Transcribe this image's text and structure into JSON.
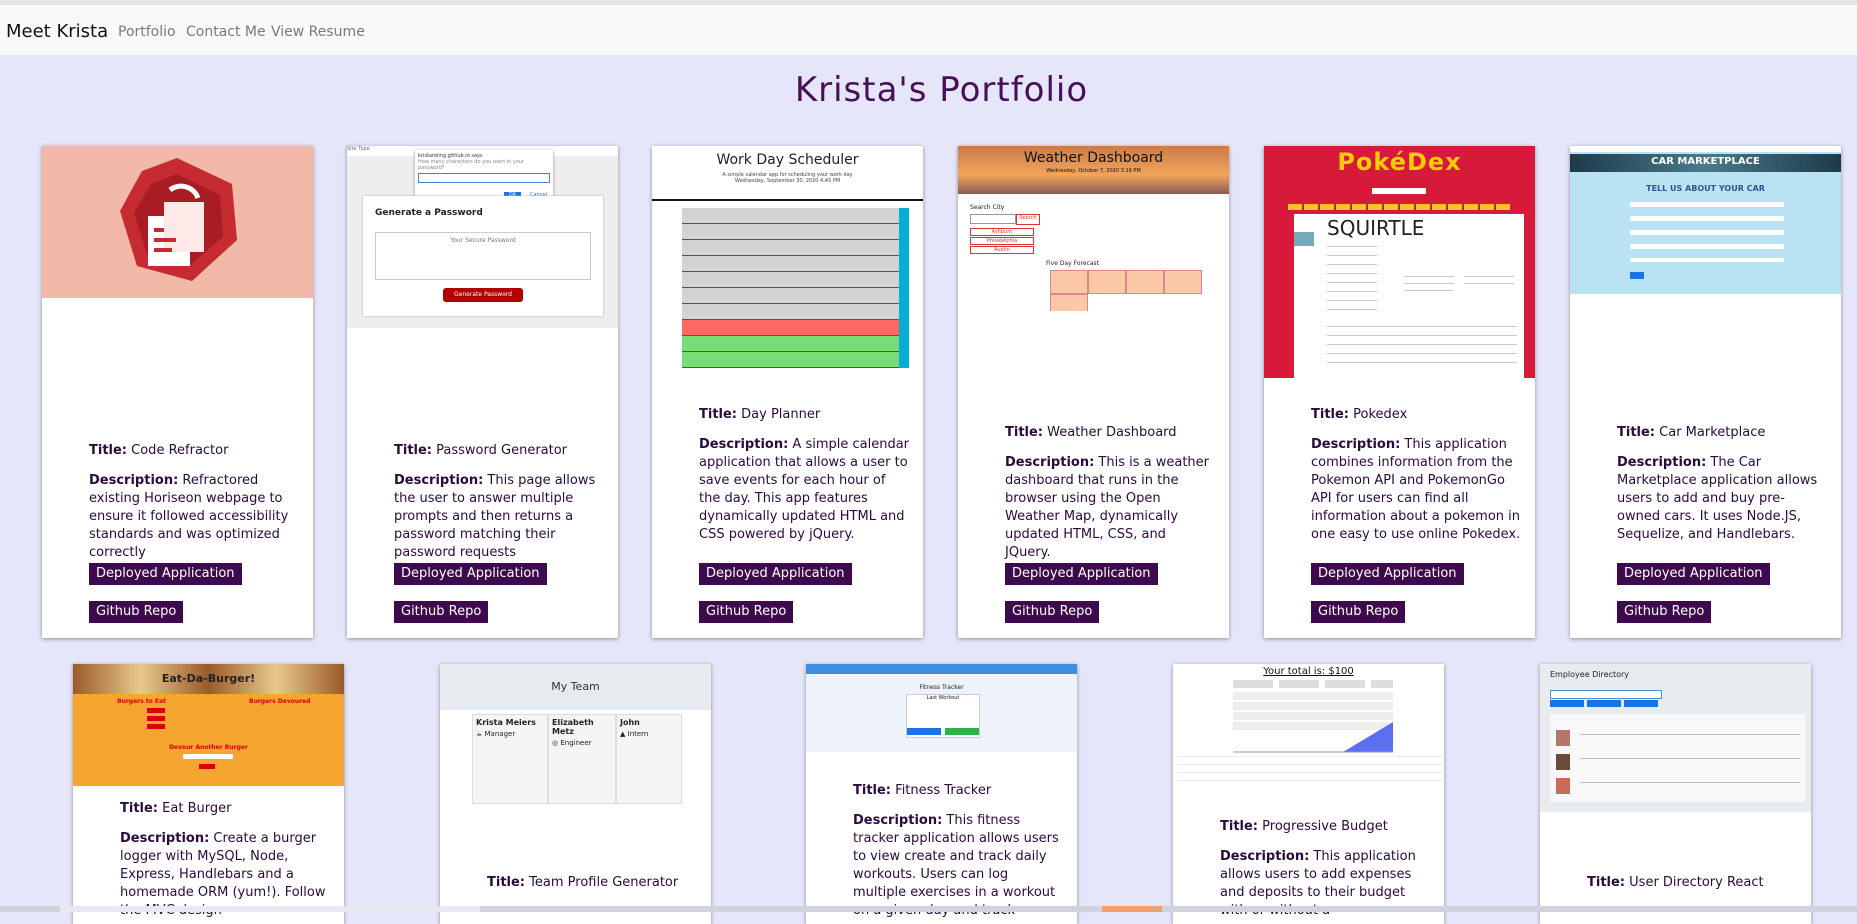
{
  "nav": {
    "brand": "Meet Krista",
    "links": [
      "Portfolio",
      "Contact Me",
      "View Resume"
    ]
  },
  "page_title": "Krista's Portfolio",
  "labels": {
    "title": "Title:",
    "description": "Description:",
    "deployed": "Deployed Application",
    "github": "Github Repo"
  },
  "projects": [
    {
      "title": "Code Refractor",
      "description": "Refractored existing Horiseon webpage to ensure it followed accessibility standards and was optimized correctly"
    },
    {
      "title": "Password Generator",
      "description": "This page allows the user to answer multiple prompts and then returns a password matching their password requests"
    },
    {
      "title": "Day Planner",
      "description": "A simple calendar application that allows a user to save events for each hour of the day. This app features dynamically updated HTML and CSS powered by jQuery."
    },
    {
      "title": "Weather Dashboard",
      "description": "This is a weather dashboard that runs in the browser using the Open Weather Map, dynamically updated HTML, CSS, and JQuery."
    },
    {
      "title": "Pokedex",
      "description": "This application combines information from the Pokemon API and PokemonGo API for users can find all information about a pokemon in one easy to use online Pokedex."
    },
    {
      "title": "Car Marketplace",
      "description": "The Car Marketplace application allows users to add and buy pre-owned cars. It uses Node.JS, Sequelize, and Handlebars."
    },
    {
      "title": "Eat Burger",
      "description": "Create a burger logger with MySQL, Node, Express, Handlebars and a homemade ORM (yum!). Follow the MVC design"
    },
    {
      "title": "Team Profile Generator",
      "description": ""
    },
    {
      "title": "Fitness Tracker",
      "description": "This fitness tracker application allows users to view create and track daily workouts. Users can log multiple exercises in a workout on a given day and track"
    },
    {
      "title": "Progressive Budget",
      "description": "This application allows users to add expenses and deposits to their budget with or without a"
    },
    {
      "title": "User Directory React",
      "description": ""
    }
  ],
  "thumbs": {
    "password": {
      "site_text": "Site Type",
      "dialog_title": "kristaroling.github.io says",
      "dialog_q": "How many characters do you want in your password?",
      "ok": "OK",
      "cancel": "Cancel",
      "heading": "Generate a Password",
      "placeholder": "Your Secure Password",
      "button": "Generate Password"
    },
    "scheduler": {
      "heading": "Work Day Scheduler",
      "sub": "A simple calendar app for scheduling your work day",
      "date": "Wednesday, September 30, 2020 4:45 PM"
    },
    "weather": {
      "heading": "Weather Dashboard",
      "date": "Wednesday, October 7, 2020 3:19 PM",
      "search_label": "Search City",
      "search_btn": "Search",
      "cities": [
        "Ashburn",
        "Philadelphia",
        "Austin"
      ],
      "forecast_label": "Five Day Forecast"
    },
    "pokedex": {
      "logo": "PokéDex",
      "name": "SQUIRTLE"
    },
    "car": {
      "heading": "CAR MARKETPLACE",
      "sub": "TELL US ABOUT YOUR CAR"
    },
    "burger": {
      "heading": "Eat-Da-Burger!",
      "left_col": "Burgers to Eat",
      "right_col": "Burgers Devoured",
      "devour": "Devour Another Burger"
    },
    "team": {
      "heading": "My Team",
      "members": [
        {
          "name": "Krista Meiers",
          "role": "Manager",
          "role_icon": "coffee-icon"
        },
        {
          "name": "Elizabeth Metz",
          "role": "Engineer",
          "role_icon": "glasses-icon"
        },
        {
          "name": "John",
          "role": "Intern",
          "role_icon": "graduate-icon"
        }
      ]
    },
    "fitness": {
      "heading": "Fitness Tracker",
      "sub": "Last Workout"
    },
    "budget": {
      "total": "Your total is: $100"
    },
    "directory": {
      "heading": "Employee Directory"
    }
  }
}
